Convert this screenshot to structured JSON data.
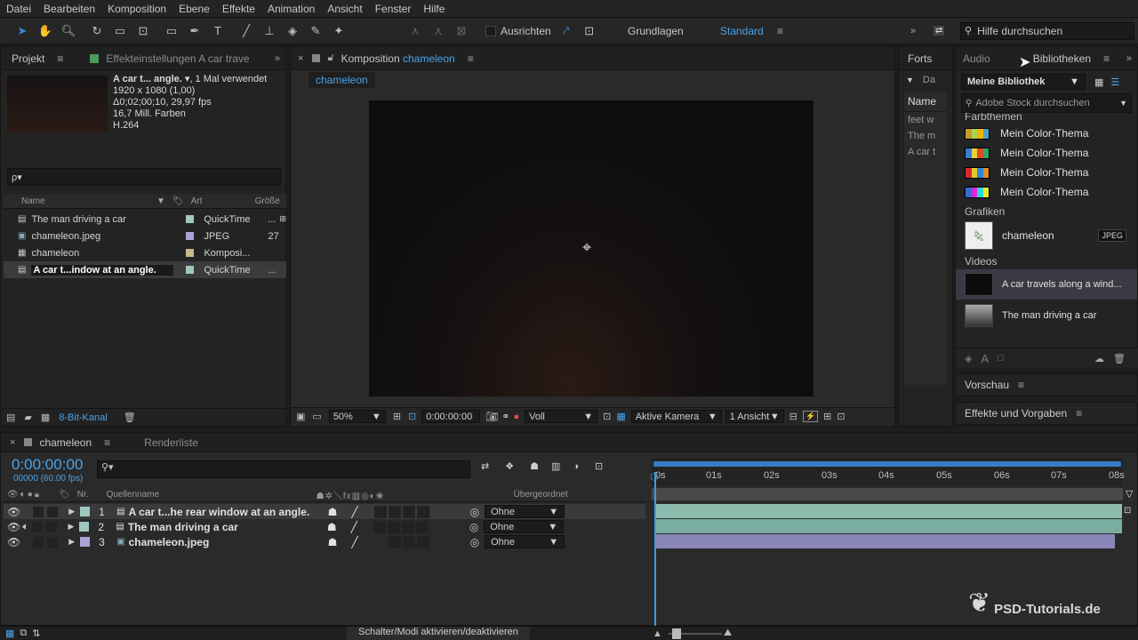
{
  "menu": [
    "Datei",
    "Bearbeiten",
    "Komposition",
    "Ebene",
    "Effekte",
    "Animation",
    "Ansicht",
    "Fenster",
    "Hilfe"
  ],
  "toolbar": {
    "tools": [
      "selection-tool",
      "hand-tool",
      "zoom-tool",
      "rotate-tool",
      "camera-tool",
      "pan-behind-tool",
      "rectangle-tool",
      "pen-tool",
      "type-tool",
      "brush-tool",
      "clone-stamp-tool",
      "eraser-tool",
      "roto-brush-tool",
      "puppet-pin-tool"
    ],
    "align_label": "Ausrichten",
    "workspace_basics": "Grundlagen",
    "workspace_standard": "Standard",
    "help_placeholder": "Hilfe durchsuchen"
  },
  "project": {
    "tab": "Projekt",
    "effect_tab": "Effekteinstellungen",
    "effect_tab_target": "A car trave",
    "info_name": "A car t... angle.",
    "info_usage": ", 1 Mal verwendet",
    "info_lines": [
      "1920 x 1080 (1,00)",
      "Δ0;02;00;10, 29,97 fps",
      "16,7 Mill. Farben",
      "H.264"
    ],
    "search_placeholder": "ρ▾",
    "columns": {
      "name": "Name",
      "type": "Art",
      "size": "Größe"
    },
    "items": [
      {
        "name": "The man driving a car",
        "type": "QuickTime",
        "size": "...",
        "color": "#9fc7c0",
        "icon": "video-file-icon"
      },
      {
        "name": "chameleon.jpeg",
        "type": "JPEG",
        "size": "27",
        "color": "#a9a4d6",
        "icon": "image-file-icon"
      },
      {
        "name": "chameleon",
        "type": "Komposi...",
        "size": "",
        "color": "#c8b98a",
        "icon": "composition-icon"
      },
      {
        "name": "A car t...indow at an angle.",
        "type": "QuickTime",
        "size": "...",
        "color": "#9fc7c0",
        "icon": "video-file-icon"
      }
    ],
    "bit_depth": "8-Bit-Kanal"
  },
  "comp": {
    "tab_prefix": "Komposition",
    "tab_name": "chameleon",
    "crumb": "chameleon",
    "zoom": "50%",
    "timecode": "0:00:00:00",
    "resolution": "Voll",
    "camera": "Aktive Kamera",
    "views": "1 Ansicht"
  },
  "fort": {
    "tab": "Forts",
    "label_da": "Da",
    "col_name": "Name",
    "rows": [
      "feet w",
      "The m",
      "A car t"
    ]
  },
  "library": {
    "tab_audio": "Audio",
    "tab_libraries": "Bibliotheken",
    "library_select": "Meine Bibliothek",
    "search_placeholder": "Adobe Stock durchsuchen",
    "section_colors": "Farbthemen",
    "color_themes": [
      {
        "label": "Mein Color-Thema",
        "colors": [
          "#c69a2a",
          "#a6d44a",
          "#f0b400",
          "#4aa0d0"
        ]
      },
      {
        "label": "Mein Color-Thema",
        "colors": [
          "#3a7bd5",
          "#e8d23a",
          "#e04a2a",
          "#2aa86a"
        ]
      },
      {
        "label": "Mein Color-Thema",
        "colors": [
          "#d82a2a",
          "#e8c82a",
          "#2a8ad8",
          "#e88a2a"
        ]
      },
      {
        "label": "Mein Color-Thema",
        "colors": [
          "#3a6ad8",
          "#d82ad8",
          "#2ad8d8",
          "#e8e82a"
        ]
      }
    ],
    "section_graphics": "Grafiken",
    "graphic": {
      "label": "chameleon",
      "badge": "JPEG"
    },
    "section_videos": "Videos",
    "videos": [
      "A car travels along a wind...",
      "The man driving a car"
    ],
    "preview_panel": "Vorschau",
    "effects_panel": "Effekte und Vorgaben"
  },
  "timeline": {
    "tab": "chameleon",
    "render_tab": "Renderliste",
    "timecode": "0:00:00:00",
    "frames": "00000 (60.00 fps)",
    "col_nr": "Nr.",
    "col_source": "Quellenname",
    "col_parent": "Übergeordnet",
    "ruler": [
      "0s",
      "01s",
      "02s",
      "03s",
      "04s",
      "05s",
      "06s",
      "07s",
      "08s"
    ],
    "layers": [
      {
        "nr": "1",
        "name": "A car t...he rear window at an angle.",
        "parent": "Ohne",
        "color": "#9fc7c0",
        "bar": "#7aaea0"
      },
      {
        "nr": "2",
        "name": "The man driving a car",
        "parent": "Ohne",
        "color": "#9fc7c0",
        "bar": "#7aaea0"
      },
      {
        "nr": "3",
        "name": "chameleon.jpeg",
        "parent": "Ohne",
        "color": "#a9a4d6",
        "bar": "#8a86b8"
      }
    ],
    "toggle_label": "Schalter/Modi aktivieren/deaktivieren"
  },
  "watermark": "PSD-Tutorials.de"
}
